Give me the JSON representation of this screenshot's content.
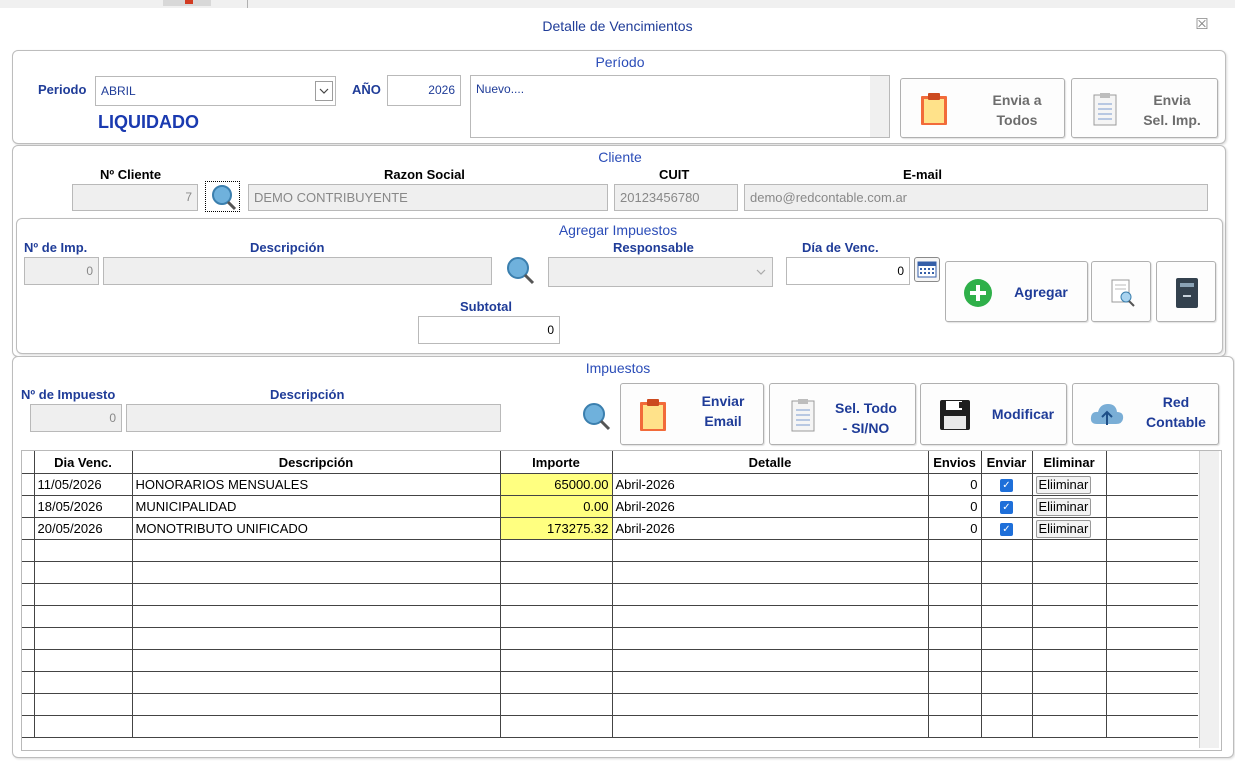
{
  "window": {
    "title": "Detalle de Vencimientos",
    "close_glyph": "☒"
  },
  "periodo": {
    "section_title": "Período",
    "periodo_label": "Periodo",
    "periodo_value": "ABRIL",
    "anio_label": "AÑO",
    "anio_value": "2026",
    "status": "LIQUIDADO",
    "notes": "Nuevo....",
    "envia_todos_label_1": "Envia a",
    "envia_todos_label_2": "Todos",
    "envia_sel_label_1": "Envia",
    "envia_sel_label_2": "Sel. Imp."
  },
  "cliente": {
    "section_title": "Cliente",
    "num_label": "Nº Cliente",
    "num_value": "7",
    "razon_label": "Razon Social",
    "razon_value": "DEMO CONTRIBUYENTE",
    "cuit_label": "CUIT",
    "cuit_value": "20123456780",
    "email_label": "E-mail",
    "email_value": "demo@redcontable.com.ar"
  },
  "agregar": {
    "section_title": "Agregar Impuestos",
    "nimp_label": "Nº de Imp.",
    "nimp_value": "0",
    "desc_label": "Descripción",
    "desc_value": "",
    "resp_label": "Responsable",
    "resp_value": "",
    "dia_label": "Día de Venc.",
    "dia_value": "0",
    "subtotal_label": "Subtotal",
    "subtotal_value": "0",
    "agregar_label": "Agregar"
  },
  "impuestos": {
    "section_title": "Impuestos",
    "nimp_label": "Nº de Impuesto",
    "nimp_value": "0",
    "desc_label": "Descripción",
    "desc_value": "",
    "enviar_email_1": "Enviar",
    "enviar_email_2": "Email",
    "sel_todo_1": "Sel. Todo",
    "sel_todo_2": "- SI/NO",
    "modificar": "Modificar",
    "red_1": "Red",
    "red_2": "Contable"
  },
  "table": {
    "headers": [
      "Dia Venc.",
      "Descripción",
      "Importe",
      "Detalle",
      "Envios",
      "Enviar",
      "Eliminar"
    ],
    "rows": [
      {
        "fecha": "11/05/2026",
        "desc": "HONORARIOS MENSUALES",
        "importe": "65000.00",
        "detalle": "Abril-2026",
        "envios": "0",
        "enviar": true,
        "eliminar": "Eliiminar"
      },
      {
        "fecha": "18/05/2026",
        "desc": "MUNICIPALIDAD",
        "importe": "0.00",
        "detalle": "Abril-2026",
        "envios": "0",
        "enviar": true,
        "eliminar": "Eliiminar"
      },
      {
        "fecha": "20/05/2026",
        "desc": "MONOTRIBUTO UNIFICADO",
        "importe": "173275.32",
        "detalle": "Abril-2026",
        "envios": "0",
        "enviar": true,
        "eliminar": "Eliiminar"
      }
    ],
    "empty_rows": 9
  },
  "colors": {
    "label_blue": "#1f3c98",
    "highlight_yellow": "#ffff80",
    "checkbox_blue": "#1e6fd9"
  }
}
